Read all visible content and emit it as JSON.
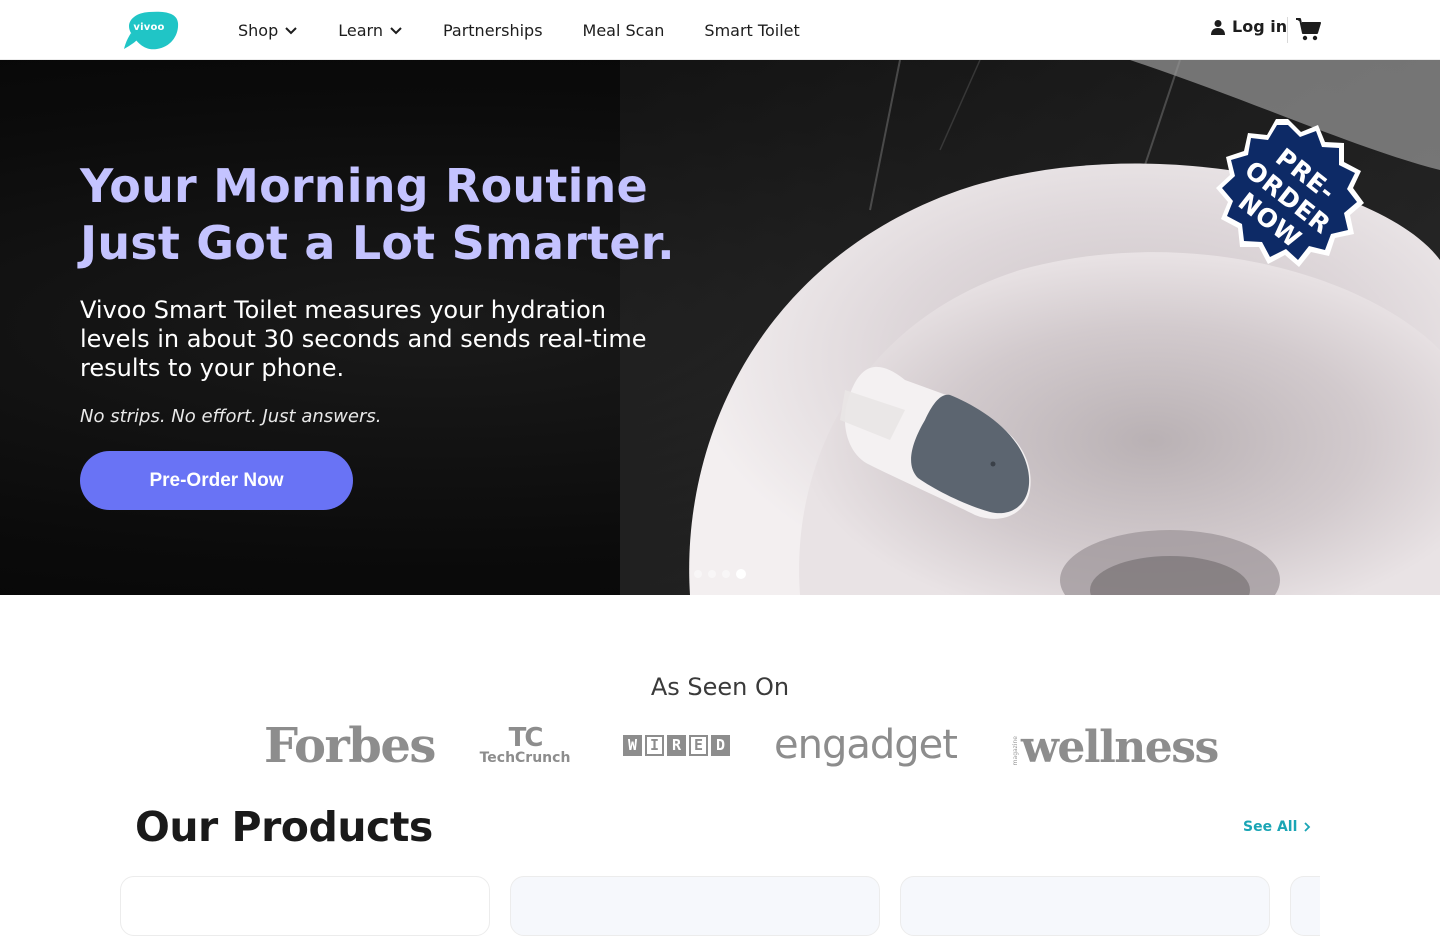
{
  "header": {
    "logo_text": "vivoo",
    "nav": [
      {
        "label": "Shop",
        "has_dropdown": true
      },
      {
        "label": "Learn",
        "has_dropdown": true
      },
      {
        "label": "Partnerships",
        "has_dropdown": false
      },
      {
        "label": "Meal Scan",
        "has_dropdown": false
      },
      {
        "label": "Smart Toilet",
        "has_dropdown": false
      }
    ],
    "login_label": "Log in",
    "icons": {
      "login": "user-icon",
      "cart": "cart-icon",
      "dropdown": "chevron-down-icon"
    }
  },
  "hero": {
    "title_line1": "Your Morning Routine",
    "title_line2": "Just Got a Lot Smarter.",
    "subtitle": "Vivoo Smart Toilet measures your hydration levels in about 30 seconds and sends real-time results to your phone.",
    "note": "No strips. No effort. Just answers.",
    "cta_label": "Pre-Order Now",
    "badge_lines": [
      "PRE-",
      "ORDER",
      "NOW"
    ],
    "carousel": {
      "slides": 4,
      "active": 4
    }
  },
  "press": {
    "title": "As Seen On",
    "logos": [
      "Forbes",
      "TechCrunch",
      "WIRED",
      "engadget",
      "wellness"
    ],
    "techcrunch_mark": "TC",
    "wellness_prefix": "magazine"
  },
  "products": {
    "title": "Our Products",
    "see_all_label": "See All"
  },
  "colors": {
    "brand_teal": "#20c5c6",
    "hero_title": "#c4c3ff",
    "cta": "#6973f5",
    "badge": "#0d2a66",
    "see_all": "#1aa5b5"
  }
}
